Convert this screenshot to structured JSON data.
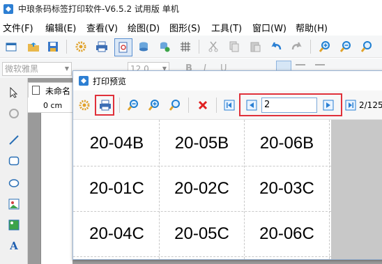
{
  "window": {
    "title": "中琅条码标签打印软件-V6.5.2 试用版 单机"
  },
  "menu": [
    "文件(F)",
    "编辑(E)",
    "查看(V)",
    "绘图(D)",
    "图形(S)",
    "工具(T)",
    "窗口(W)",
    "帮助(H)"
  ],
  "format_bar": {
    "font_name": "微软雅黑",
    "font_size": "12.0"
  },
  "document": {
    "tab_label": "未命名",
    "ruler_label": "0 cm"
  },
  "preview": {
    "title": "打印预览",
    "page_input": "2",
    "page_count": "2/125"
  },
  "labels": [
    [
      "20-04B",
      "20-05B",
      "20-06B"
    ],
    [
      "20-01C",
      "20-02C",
      "20-03C"
    ],
    [
      "20-04C",
      "20-05C",
      "20-06C"
    ]
  ],
  "colors": {
    "highlight_red": "#e0303a",
    "icon_blue": "#1f7fd1"
  }
}
